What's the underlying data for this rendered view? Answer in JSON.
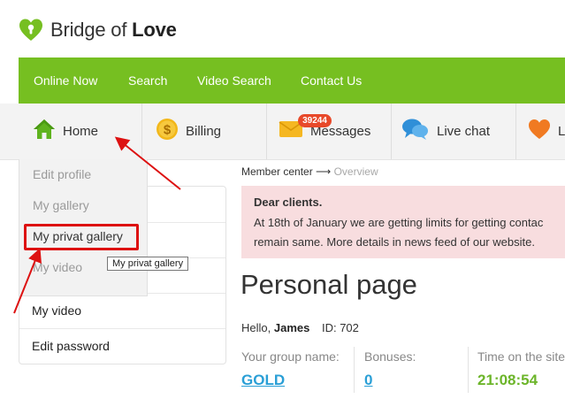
{
  "logo": {
    "text_regular": "Bridge of ",
    "text_bold": "Love"
  },
  "topnav": {
    "items": [
      "Online Now",
      "Search",
      "Video Search",
      "Contact Us"
    ]
  },
  "iconbar": {
    "home": "Home",
    "billing": "Billing",
    "messages": "Messages",
    "messages_badge": "39244",
    "live_chat": "Live chat",
    "love_partial": "L"
  },
  "dropdown": {
    "items": [
      "Edit profile",
      "My gallery",
      "My privat gallery",
      "My video"
    ],
    "tooltip": "My privat gallery"
  },
  "sidebar": {
    "items": [
      "My video",
      "Edit password"
    ]
  },
  "breadcrumb": {
    "root": "Member center",
    "arrow": "⟶",
    "current": "Overview"
  },
  "alert": {
    "title": "Dear clients.",
    "line1": "At 18th of January we are getting limits for getting contac",
    "line2": "remain same. More details in news feed of our website."
  },
  "page": {
    "title": "Personal page",
    "hello_prefix": "Hello, ",
    "user_name": "James",
    "id_label": "ID: 702"
  },
  "stats": {
    "group_label": "Your group name:",
    "group_value": "GOLD",
    "bonuses_label": "Bonuses:",
    "bonuses_value": "0",
    "time_label": "Time on the site",
    "time_value": "21:08:54"
  },
  "colors": {
    "brand_green": "#76bf21",
    "badge_red": "#e8492a",
    "highlight_red": "#dd1111",
    "link_blue": "#2a9fd6",
    "time_green": "#6cb52a"
  }
}
